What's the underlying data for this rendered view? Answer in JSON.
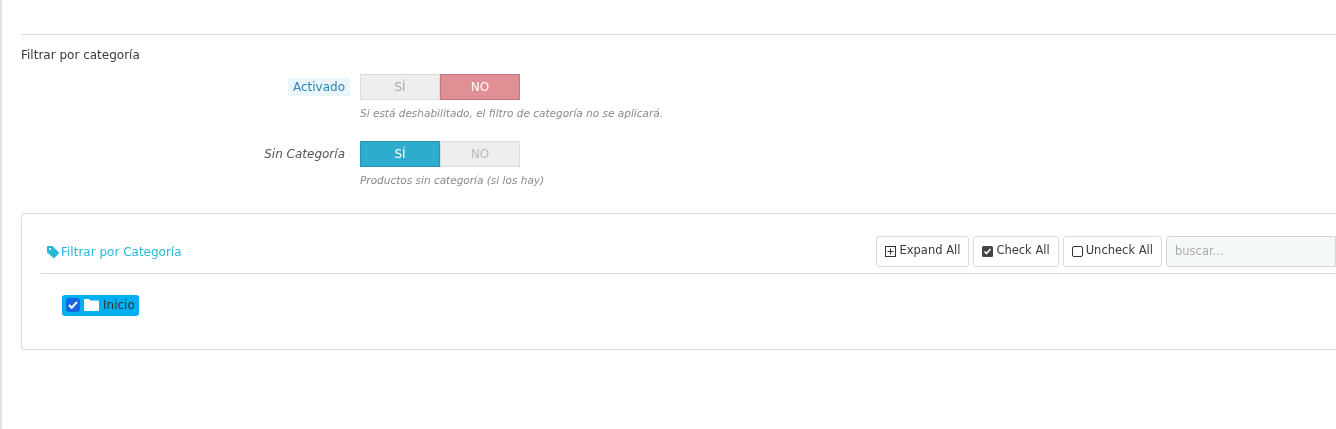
{
  "section_title": "Filtrar por categoría",
  "switches": [
    {
      "label": "Activado",
      "highlighted": true,
      "options": [
        {
          "label": "SÍ",
          "kind": "yes",
          "selected": false
        },
        {
          "label": "NO",
          "kind": "no",
          "selected": true
        }
      ],
      "help": "Si está deshabilitado, el filtro de categoría no se aplicará."
    },
    {
      "label": "Sin Categoría",
      "highlighted": false,
      "options": [
        {
          "label": "SÍ",
          "kind": "yes",
          "selected": true
        },
        {
          "label": "NO",
          "kind": "no",
          "selected": false
        }
      ],
      "help": "Productos sin categoría (si los hay)"
    }
  ],
  "tree_panel": {
    "title": "Filtrar por Categoría",
    "buttons": [
      {
        "label": "Expand All",
        "kind": "expand"
      },
      {
        "label": "Check All",
        "kind": "check"
      },
      {
        "label": "Uncheck All",
        "kind": "uncheck"
      }
    ],
    "search": {
      "placeholder": "buscar..."
    },
    "items": [
      {
        "label": "Inicio",
        "checked": true
      }
    ]
  }
}
